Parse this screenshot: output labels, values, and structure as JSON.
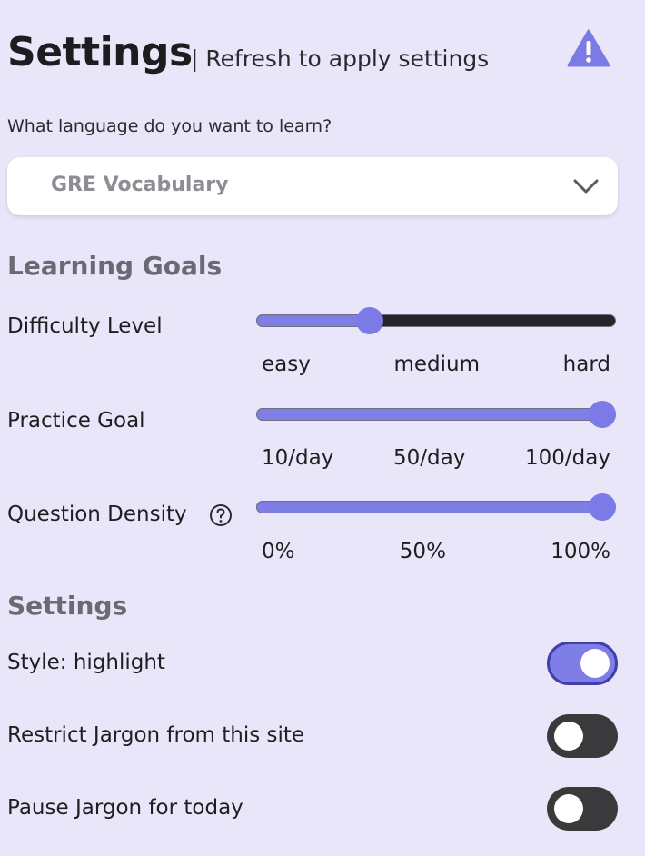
{
  "header": {
    "title": "Settings",
    "subtitle": "| Refresh to apply settings",
    "icon": "warning-icon"
  },
  "language": {
    "question": "What language do you want to learn?",
    "selected": "GRE Vocabulary"
  },
  "learning_goals": {
    "heading": "Learning Goals",
    "difficulty": {
      "label": "Difficulty Level",
      "ticks": [
        "easy",
        "medium",
        "hard"
      ],
      "value_fraction": 0.3
    },
    "practice": {
      "label": "Practice Goal",
      "ticks": [
        "10/day",
        "50/day",
        "100/day"
      ],
      "value_fraction": 1.0
    },
    "density": {
      "label": "Question Density",
      "ticks": [
        "0%",
        "50%",
        "100%"
      ],
      "value_fraction": 1.0
    }
  },
  "settings": {
    "heading": "Settings",
    "toggles": [
      {
        "label": "Style: highlight",
        "on": true
      },
      {
        "label": "Restrict Jargon from this site",
        "on": false
      },
      {
        "label": "Pause Jargon for today",
        "on": false
      }
    ]
  },
  "colors": {
    "background": "#e9e6f9",
    "accent": "#7f7ee6",
    "track_dark": "#26262a",
    "toggle_off": "#3a3a3d"
  }
}
